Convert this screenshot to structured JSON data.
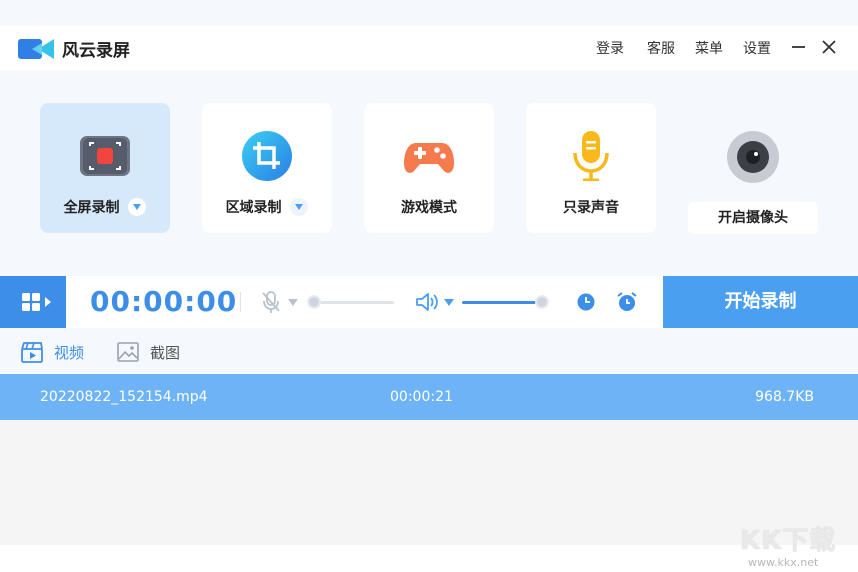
{
  "app": {
    "title": "风云录屏"
  },
  "header": {
    "menu": [
      "登录",
      "客服",
      "菜单",
      "设置"
    ]
  },
  "modes": [
    {
      "label": "全屏录制",
      "icon": "fullscreen-record-icon",
      "selected": true,
      "has_dropdown": true
    },
    {
      "label": "区域录制",
      "icon": "region-crop-icon",
      "selected": false,
      "has_dropdown": true
    },
    {
      "label": "游戏模式",
      "icon": "gamepad-icon",
      "selected": false,
      "has_dropdown": false
    },
    {
      "label": "只录声音",
      "icon": "microphone-icon",
      "selected": false,
      "has_dropdown": false
    },
    {
      "label": "开启摄像头",
      "icon": "camera-icon",
      "selected": false,
      "has_dropdown": false
    }
  ],
  "controls": {
    "timer": "00:00:00",
    "mic_level": 0,
    "speaker_level": 1.0,
    "start_label": "开始录制"
  },
  "tabs": [
    {
      "label": "视频",
      "icon": "video-clapper-icon",
      "active": true
    },
    {
      "label": "截图",
      "icon": "image-icon",
      "active": false
    }
  ],
  "files": [
    {
      "name": "20220822_152154.mp4",
      "duration": "00:00:21",
      "size": "968.7KB"
    }
  ],
  "watermark": {
    "title": "KK下载",
    "url": "www.kkx.net"
  },
  "colors": {
    "accent": "#3d8ee8",
    "start_button": "#4a9ff0",
    "selected_row": "#6fb3f7",
    "selected_card": "#d6e9fb"
  }
}
